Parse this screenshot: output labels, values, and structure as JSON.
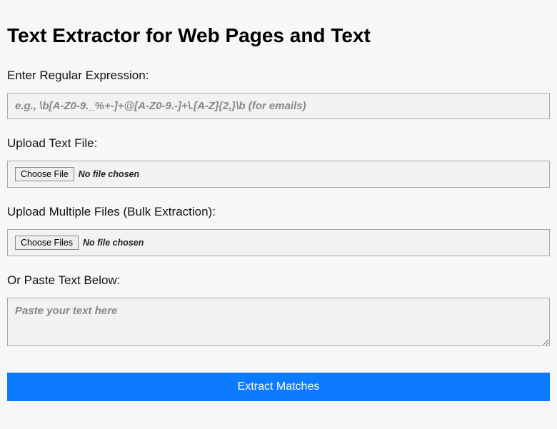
{
  "title": "Text Extractor for Web Pages and Text",
  "regex": {
    "label": "Enter Regular Expression:",
    "placeholder": "e.g., \\b[A-Z0-9._%+-]+@[A-Z0-9.-]+\\.[A-Z]{2,}\\b (for emails)",
    "value": ""
  },
  "single_file": {
    "label": "Upload Text File:",
    "button": "Choose File",
    "status": "No file chosen"
  },
  "multi_file": {
    "label": "Upload Multiple Files (Bulk Extraction):",
    "button": "Choose Files",
    "status": "No file chosen"
  },
  "paste": {
    "label": "Or Paste Text Below:",
    "placeholder": "Paste your text here",
    "value": ""
  },
  "submit": {
    "label": "Extract Matches"
  }
}
